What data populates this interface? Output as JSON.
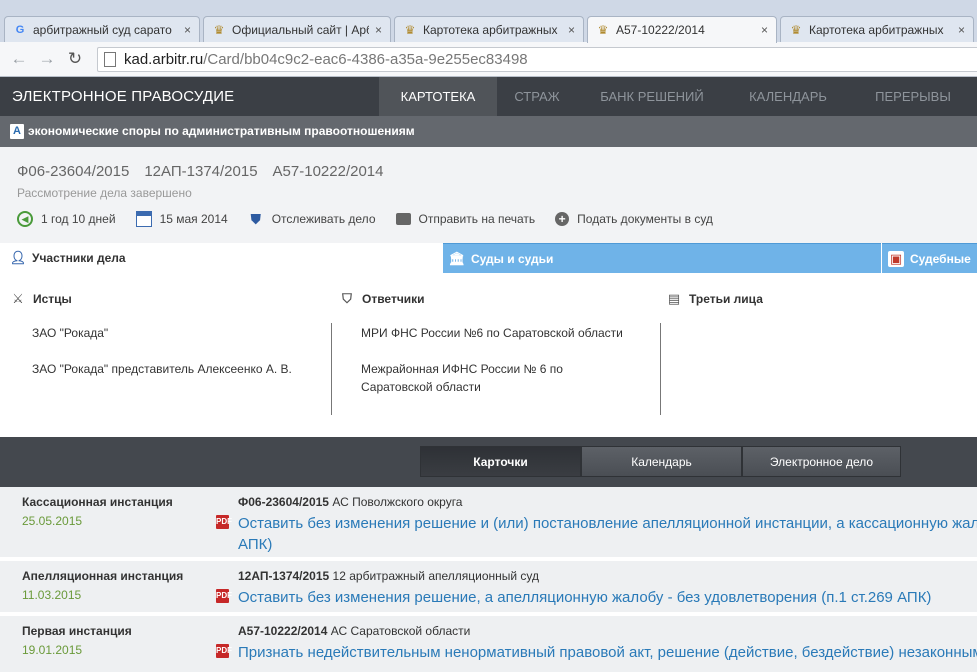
{
  "browser": {
    "tabs": [
      {
        "title": "арбитражный суд сарато",
        "icon": "google-icon"
      },
      {
        "title": "Официальный сайт | Арб",
        "icon": "emblem-icon"
      },
      {
        "title": "Картотека арбитражных",
        "icon": "emblem-icon"
      },
      {
        "title": "А57-10222/2014",
        "icon": "emblem-icon",
        "active": true
      },
      {
        "title": "Картотека арбитражных",
        "icon": "emblem-icon"
      }
    ],
    "close_glyph": "×",
    "url_host": "kad.arbitr.ru",
    "url_path": "/Card/bb04c9c2-eac6-4386-a35a-9e255ec83498"
  },
  "site": {
    "brand": "ЭЛЕКТРОННОЕ ПРАВОСУДИЕ",
    "nav": [
      "КАРТОТЕКА",
      "СТРАЖ",
      "БАНК РЕШЕНИЙ",
      "КАЛЕНДАРЬ",
      "ПЕРЕРЫВЫ"
    ],
    "nav_active": "КАРТОТЕКА",
    "category_icon": "A",
    "category": "экономические споры по административным правоотношениям"
  },
  "case": {
    "numbers": [
      "Ф06-23604/2015",
      "12АП-1374/2015",
      "А57-10222/2014"
    ],
    "status": "Рассмотрение дела завершено",
    "actions": [
      {
        "label": "1 год 10 дней",
        "icon": "clock-icon"
      },
      {
        "label": "15 мая 2014",
        "icon": "calendar-icon"
      },
      {
        "label": "Отслеживать дело",
        "icon": "shield-icon"
      },
      {
        "label": "Отправить на печать",
        "icon": "printer-icon"
      },
      {
        "label": "Подать документы в суд",
        "icon": "plus-icon"
      }
    ]
  },
  "section_tabs": {
    "participants": "Участники дела",
    "courts": "Суды и судьи",
    "documents": "Судебные"
  },
  "parties": {
    "plaintiffs": {
      "title": "Истцы",
      "items": [
        "ЗАО \"Рокада\"",
        "ЗАО \"Рокада\" представитель Алексеенко А. В."
      ]
    },
    "defendants": {
      "title": "Ответчики",
      "items": [
        "МРИ ФНС России №6 по Саратовской области",
        "Межрайонная ИФНС России № 6 по",
        "Саратовской области"
      ]
    },
    "third": {
      "title": "Третьи лица",
      "items": []
    }
  },
  "switcher": [
    "Карточки",
    "Календарь",
    "Электронное дело"
  ],
  "switcher_active": "Карточки",
  "instances": [
    {
      "level": "Кассационная инстанция",
      "date": "25.05.2015",
      "case_number": "Ф06-23604/2015",
      "court": "АС Поволжского округа",
      "decision_line1": "Оставить без изменения решение и (или) постановление апелляционной инстанции, а кассационную жало",
      "decision_line2": "АПК)"
    },
    {
      "level": "Апелляционная инстанция",
      "date": "11.03.2015",
      "case_number": "12АП-1374/2015",
      "court": "12 арбитражный апелляционный суд",
      "decision_line1": "Оставить без изменения решение, а апелляционную жалобу - без удовлетворения (п.1 ст.269 АПК)",
      "decision_line2": ""
    },
    {
      "level": "Первая инстанция",
      "date": "19.01.2015",
      "case_number": "А57-10222/2014",
      "court": "АС Саратовской области",
      "decision_line1": "Признать недействительным ненормативный правовой акт, решение (действие, бездействие) незаконным",
      "decision_line2": ""
    }
  ],
  "pdf_label": "PDF"
}
